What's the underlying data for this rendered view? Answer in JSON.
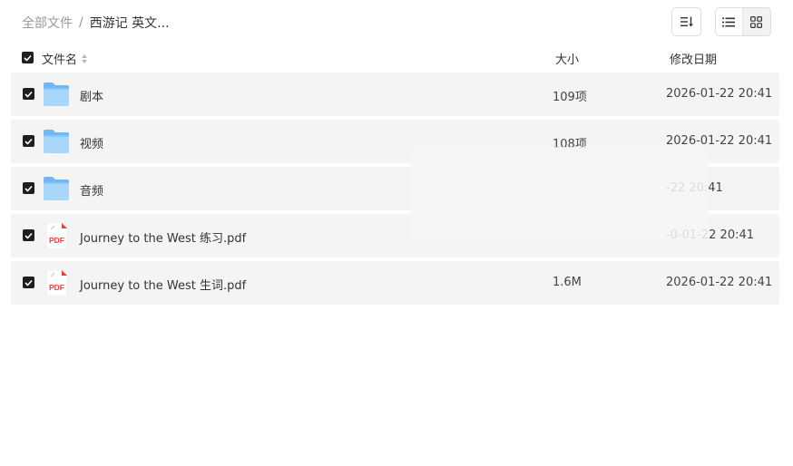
{
  "breadcrumb": {
    "root": "全部文件",
    "separator": "/",
    "current": "西游记 英文..."
  },
  "toolbar": {
    "sort_icon": "sort-list-icon",
    "view_list_icon": "list-view-icon",
    "view_grid_icon": "grid-view-icon",
    "active_view": "list"
  },
  "columns": {
    "name": "文件名",
    "size": "大小",
    "date": "修改日期"
  },
  "select_all_checked": true,
  "files": [
    {
      "name": "剧本",
      "type": "folder",
      "size": "109项",
      "date": "2026-01-22 20:41",
      "checked": true
    },
    {
      "name": "视频",
      "type": "folder",
      "size": "108项",
      "date": "2026-01-22 20:41",
      "checked": true
    },
    {
      "name": "音频",
      "type": "folder",
      "size": "",
      "date": "-22 20:41",
      "checked": true
    },
    {
      "name": "Journey to the West 练习.pdf",
      "type": "pdf",
      "size": "",
      "date": "-0-01-22 20:41",
      "checked": true
    },
    {
      "name": "Journey to the West 生词.pdf",
      "type": "pdf",
      "size": "1.6M",
      "date": "2026-01-22 20:41",
      "checked": true
    }
  ],
  "pdf_icon_label": "PDF",
  "colors": {
    "folder_light": "#a9d6fb",
    "folder_dark": "#6fb7f5",
    "pdf_red": "#e64340",
    "row_bg": "#f4f4f4",
    "checkbox": "#1f1f1f"
  }
}
